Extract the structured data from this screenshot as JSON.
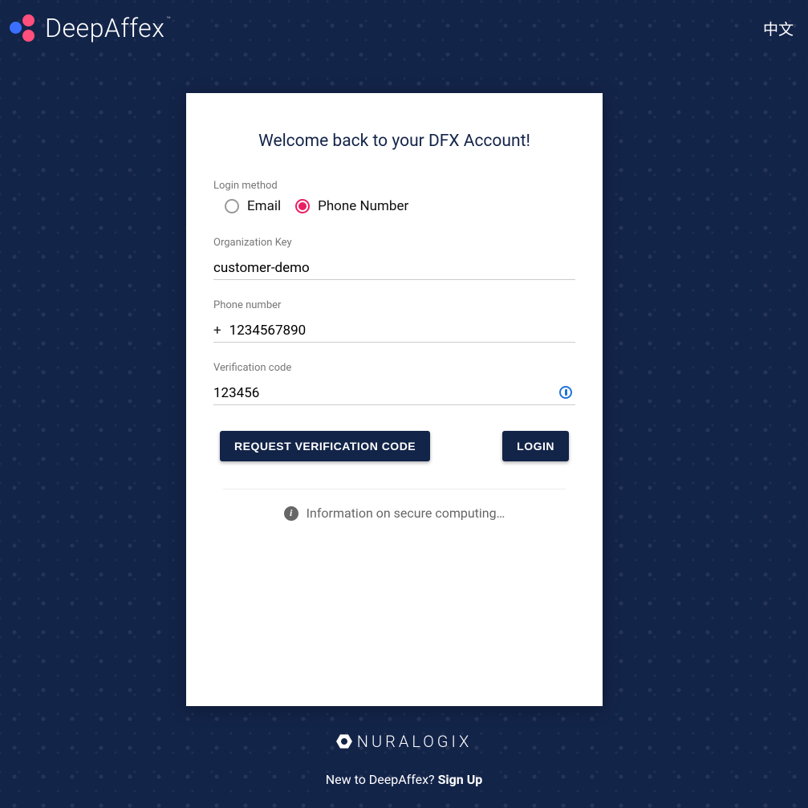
{
  "header": {
    "brand": "DeepAffex",
    "tm": "™",
    "lang_switch": "中文"
  },
  "card": {
    "title": "Welcome back to your DFX Account!",
    "login_method_label": "Login method",
    "radio_email": "Email",
    "radio_phone": "Phone Number",
    "selected_method": "phone",
    "org_key_label": "Organization Key",
    "org_key_value": "customer-demo",
    "phone_label": "Phone number",
    "phone_prefix": "+",
    "phone_value": "1234567890",
    "verif_label": "Verification code",
    "verif_value": "123456",
    "request_btn": "REQUEST VERIFICATION CODE",
    "login_btn": "LOGIN",
    "info_text": "Information on secure computing…"
  },
  "footer": {
    "company": "nuraLOGIX",
    "text_prefix": "New to DeepAffex? ",
    "signup": "Sign Up"
  }
}
